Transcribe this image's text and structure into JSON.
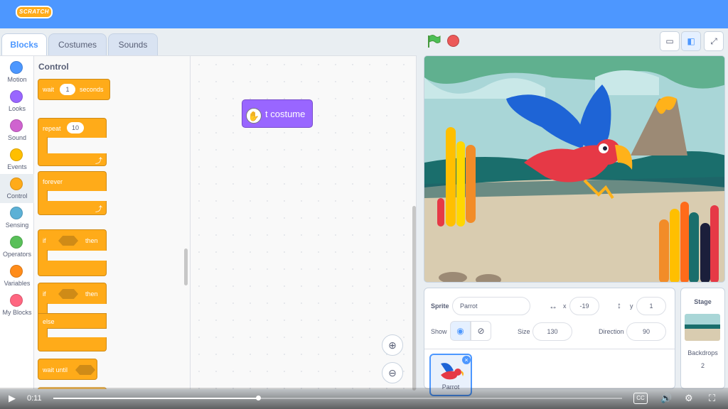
{
  "app": {
    "logo_text": "SCRATCH",
    "brand_color": "#4d97ff"
  },
  "tabs": [
    {
      "label": "Blocks",
      "active": true
    },
    {
      "label": "Costumes",
      "active": false
    },
    {
      "label": "Sounds",
      "active": false
    }
  ],
  "categories": [
    {
      "label": "Motion",
      "color": "#4c97ff"
    },
    {
      "label": "Looks",
      "color": "#9966ff"
    },
    {
      "label": "Sound",
      "color": "#cf63cf"
    },
    {
      "label": "Events",
      "color": "#ffbf00"
    },
    {
      "label": "Control",
      "color": "#ffab19",
      "selected": true
    },
    {
      "label": "Sensing",
      "color": "#5cb1d6"
    },
    {
      "label": "Operators",
      "color": "#59c059"
    },
    {
      "label": "Variables",
      "color": "#ff8c1a"
    },
    {
      "label": "My Blocks",
      "color": "#ff6680"
    }
  ],
  "palette": {
    "title": "Control",
    "wait_label": "wait",
    "wait_value": "1",
    "wait_unit": "seconds",
    "repeat_label": "repeat",
    "repeat_value": "10",
    "forever_label": "forever",
    "if_label": "if",
    "then_label": "then",
    "else_label": "else",
    "wait_until_label": "wait until"
  },
  "workspace": {
    "block_text": "next costume",
    "block_visible_text": "t costume"
  },
  "stage_controls": {
    "flag_icon": "green-flag-icon",
    "stop_icon": "stop-icon"
  },
  "sprite_info": {
    "sprite_label": "Sprite",
    "sprite_name": "Parrot",
    "x_label": "x",
    "x_value": "-19",
    "y_label": "y",
    "y_value": "1",
    "show_label": "Show",
    "size_label": "Size",
    "size_value": "130",
    "direction_label": "Direction",
    "direction_value": "90"
  },
  "sprites": [
    {
      "name": "Parrot",
      "selected": true
    }
  ],
  "stage_panel": {
    "title": "Stage",
    "backdrops_label": "Backdrops",
    "backdrops_count": "2"
  },
  "player": {
    "time": "0:11",
    "progress": 0.36,
    "cc_label": "CC"
  }
}
